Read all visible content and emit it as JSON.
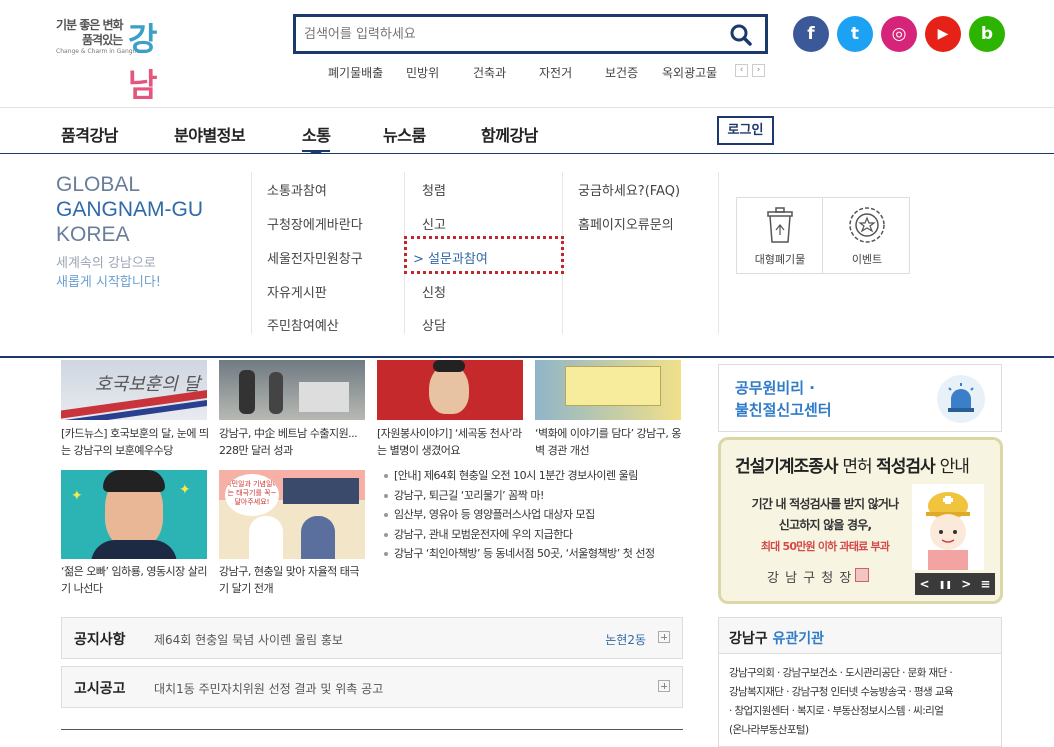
{
  "header": {
    "logo": {
      "line1": "기분 좋은 변화",
      "line2": "품격있는",
      "tagline": "Change & Charm in Gangnam",
      "big_a": "강",
      "big_b": "남"
    },
    "search_placeholder": "검색어를 입력하세요",
    "keywords": [
      "폐기물배출",
      "민방위",
      "건축과",
      "자전거",
      "보건증",
      "옥외광고물"
    ],
    "kw_prev": "‹",
    "kw_next": "›",
    "social": [
      {
        "name": "facebook",
        "glyph": "f",
        "color": "#3b5998"
      },
      {
        "name": "twitter",
        "glyph": "t",
        "color": "#1da1f2"
      },
      {
        "name": "instagram",
        "glyph": "◎",
        "color": "#d6247a"
      },
      {
        "name": "youtube",
        "glyph": "▶",
        "color": "#e62117"
      },
      {
        "name": "blog",
        "glyph": "b",
        "color": "#2db400"
      }
    ]
  },
  "gnb": {
    "items": [
      "품격강남",
      "분야별정보",
      "소통",
      "뉴스룸",
      "함께강남"
    ],
    "active": "소통",
    "login": "로그인"
  },
  "mega": {
    "brand": [
      "GLOBAL",
      "GANGNAM-GU",
      "KOREA"
    ],
    "slogan1": "세계속의 강남으로",
    "slogan2": "새롭게 시작합니다!",
    "col1": [
      "소통과참여",
      "구청장에게바란다",
      "세울전자민원창구",
      "자유게시판",
      "주민참여예산"
    ],
    "col2": [
      "청렴",
      "신고",
      "설문과참여",
      "신청",
      "상담"
    ],
    "col2_selected_marker": ">",
    "col3": [
      "궁금하세요?(FAQ)",
      "홈페이지오류문의"
    ],
    "quick": [
      "대형폐기물",
      "이벤트"
    ]
  },
  "content": {
    "thumb1_text": "호국보훈의 달",
    "thumb_captions_row1": [
      "[카드뉴스] 호국보훈의 달, 눈에 띄는 강남구의 보훈예우수당",
      "강남구, 中企 베트남 수출지원... 228만 달러 성과",
      "[자원봉사이야기] ‘세곡동 천사’라는 별명이 생겼어요",
      "‘벽화에 이야기를 담다’ 강남구, 옹벽 경관 개선"
    ],
    "thumb_captions_row2": [
      "‘젊은 오빠’ 임하룡, 영동시장 살리기 나선다",
      "강남구, 현충일 맞아 자율적 태극기 달기 전개"
    ],
    "thumb6_text": "국민일과 기념일에는 태극기를 꼭~ 달아주세요!",
    "news": [
      "[안내] 제64회 현충일 오전 10시 1분간 경보사이렌 울림",
      "강남구, 퇴근길 ‘꼬리물기’ 꼼짝 마!",
      "임산부, 영유아 등 영양플러스사업 대상자 모집",
      "강남구, 관내 모범운전자에 우의 지급한다",
      "강남구 ‘최인아책방’ 등 동네서점 50곳, ‘서울형책방’ 첫 선정"
    ],
    "notice": {
      "label": "공지사항",
      "text": "제64회 현충일 묵념 사이렌 울림 홍보",
      "dept": "논현2동"
    },
    "gosi": {
      "label": "고시공고",
      "text": "대치1동 주민자치위원 선정 결과 및 위촉 공고"
    }
  },
  "side": {
    "anti": {
      "line1": "공무원비리 ·",
      "line2": "불친절신고센터"
    },
    "banner": {
      "title_a": "건설기계조종사 ",
      "title_b": "면허 ",
      "title_c": "적성검사 ",
      "title_d": "안내",
      "body1": "기간 내 적성검사를 받지 않거나",
      "body2": "신고하지 않을 경우,",
      "penalty": "최대 50만원 이하 과태료 부과",
      "office": "강 남 구 청 장",
      "ctrl": [
        "<",
        "❚❚",
        ">",
        "≡"
      ]
    },
    "org": {
      "title_a": "강남구 ",
      "title_b": "유관기관",
      "lines": [
        "강남구의회 · 강남구보건소 · 도시관리공단 · 문화 재단 ·",
        "강남복지재단 · 강남구청 인터넷 수능방송국 · 평생 교육",
        "· 창업지원센터 · 복지로 · 부동산정보시스템 · 씨:리얼",
        "(온나라부동산포털)"
      ]
    }
  }
}
